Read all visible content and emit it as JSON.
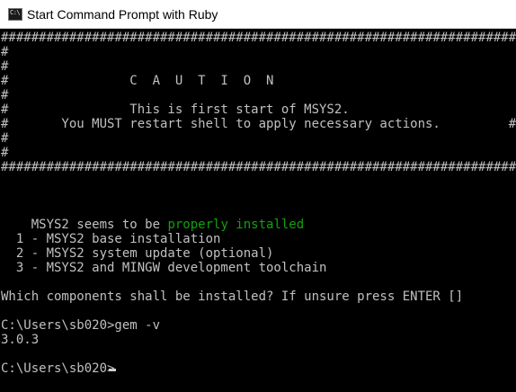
{
  "window": {
    "title": "Start Command Prompt with Ruby",
    "icon": "cmd-icon",
    "icon_text": "C:\\"
  },
  "console": {
    "border_line": "#####################################################################",
    "side_line": "#                                                                   #",
    "caution": "#                C  A  U  T  I  O  N                                #",
    "first_start": "#                This is first start of MSYS2.                      #",
    "must_restart": "#       You MUST restart shell to apply necessary actions.         #",
    "msys_prefix": "MSYS2 seems to be ",
    "msys_status": "properly installed",
    "option_1": "  1 - MSYS2 base installation",
    "option_2": "  2 - MSYS2 system update (optional)",
    "option_3": "  3 - MSYS2 and MINGW development toolchain",
    "question": "Which components shall be installed? If unsure press ENTER []",
    "prompt_1": "C:\\Users\\sb020>gem -v",
    "output_1": "3.0.3",
    "prompt_2": "C:\\Users\\sb020>",
    "status_color": "#13a10e"
  }
}
